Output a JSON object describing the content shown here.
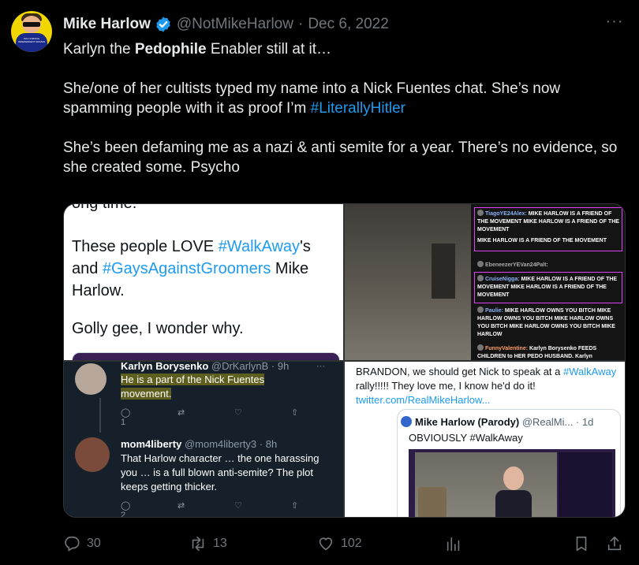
{
  "tweet": {
    "author_name": "Mike Harlow",
    "handle": "@NotMikeHarlow",
    "separator": "·",
    "date": "Dec 6, 2022",
    "more": "···",
    "text_line1_a": "Karlyn the ",
    "text_line1_bold": "Pedophile",
    "text_line1_b": " Enabler still at it…",
    "text_para2": "She/one of her cultists typed my name into a Nick Fuentes chat. She’s now spamming people with it as proof I’m ",
    "text_para2_hashtag": "#LiterallyHitler",
    "text_para3": "She’s been defaming me as a nazi & anti semite for a year. There’s no evidence, so she created some. Psycho",
    "avatar_shirt_text": "I'M A STRONG INDEPENDENT WOMAN"
  },
  "media": {
    "cell1": {
      "cut_text": "ong time.",
      "line_a": "These people LOVE ",
      "hashtag_walkaway": "#WalkAway",
      "line_b": "'s and ",
      "hashtag_gays": "#GaysAgainstGroomers",
      "line_c": " Mike Harlow.",
      "line_d": "Golly gee, I wonder why."
    },
    "cell2": {
      "messages": [
        {
          "user": "TiagoYE24Alex:",
          "text": " MIKE HARLOW IS A FRIEND OF THE MOVEMENT MIKE HARLOW IS A FRIEND OF THE MOVEMENT"
        },
        {
          "user": "",
          "text": "MIKE HARLOW IS A FRIEND OF THE MOVEMENT"
        },
        {
          "user": "EbeneezerYEVan24Palt:",
          "text": ""
        },
        {
          "user": "CruiseNigga:",
          "text": " MIKE HARLOW IS A FRIEND OF THE MOVEMENT MIKE HARLOW IS A FRIEND OF THE MOVEMENT"
        },
        {
          "user": "Paulie:",
          "text": " MIKE HARLOW OWNS YOU BITCH MIKE HARLOW OWNS YOU BITCH MIKE HARLOW OWNS YOU BITCH MIKE HARLOW OWNS YOU BITCH MIKE HARLOW"
        },
        {
          "user": "FunnyValentine:",
          "text": " Karlyn Borysenko FEEDS CHILDREN to HER PEDO HUSBAND. Karlyn"
        }
      ]
    },
    "cell3": {
      "reply1_name": "Karlyn Borysenko",
      "reply1_handle": "@DrKarlynB · 9h",
      "reply1_text_a": "He is a part of the Nick Fuentes",
      "reply1_text_b": "movement.",
      "reply1_replies": "1",
      "reply2_name": "mom4liberty",
      "reply2_handle": "@mom4liberty3 · 8h",
      "reply2_text": "That Harlow character … the one harassing you … is a full blown anti-semite? The plot keeps getting thicker.",
      "reply2_replies": "2",
      "dots": "···"
    },
    "cell4": {
      "text_a": "BRANDON, we should get Nick to speak at a ",
      "hashtag": "#WalkAway",
      "text_b": " rally!!!!! They love me, I know he'd do it! ",
      "link": "twitter.com/RealMikeHarlow...",
      "quote_name": "Mike Harlow (Parody)",
      "quote_handle": "@RealMi... · 1d",
      "quote_text": "OBVIOUSLY #WalkAway"
    }
  },
  "actions": {
    "replies": "30",
    "retweets": "13",
    "likes": "102"
  },
  "colors": {
    "background": "#000000",
    "text": "#e7e9ea",
    "muted": "#71767b",
    "link": "#1d9bf0",
    "verified": "#1d9bf0"
  }
}
